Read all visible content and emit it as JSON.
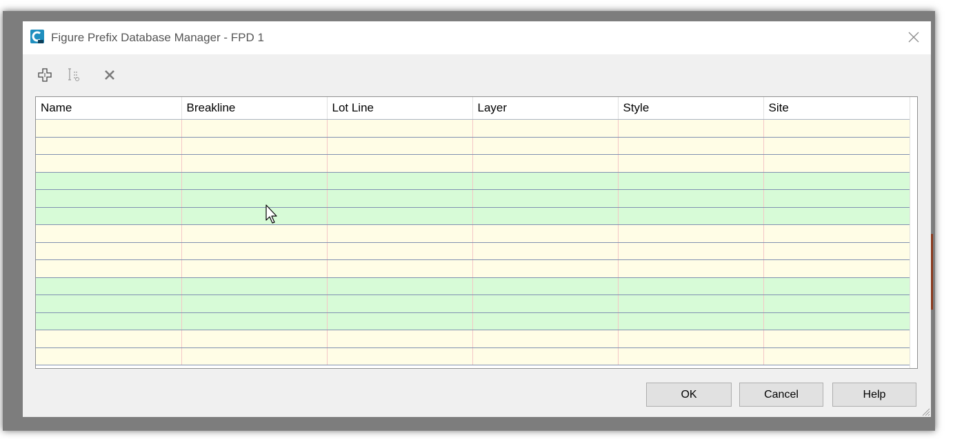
{
  "window": {
    "title": "Figure Prefix Database Manager - FPD 1"
  },
  "toolbar": {
    "items": [
      {
        "icon": "add-icon",
        "label": "New"
      },
      {
        "icon": "copy-icon",
        "label": "Copy"
      },
      {
        "icon": "delete-icon",
        "label": "Delete"
      }
    ]
  },
  "table": {
    "columns": [
      "Name",
      "Breakline",
      "Lot Line",
      "Layer",
      "Style",
      "Site"
    ],
    "row_count": 14,
    "row_colors": [
      "#fffde6",
      "#d7fbd7"
    ]
  },
  "buttons": {
    "ok": "OK",
    "cancel": "Cancel",
    "help": "Help"
  },
  "colors": {
    "accent": "#1f8fbf",
    "row_yellow": "#fffde6",
    "row_green": "#d7fbd7"
  }
}
